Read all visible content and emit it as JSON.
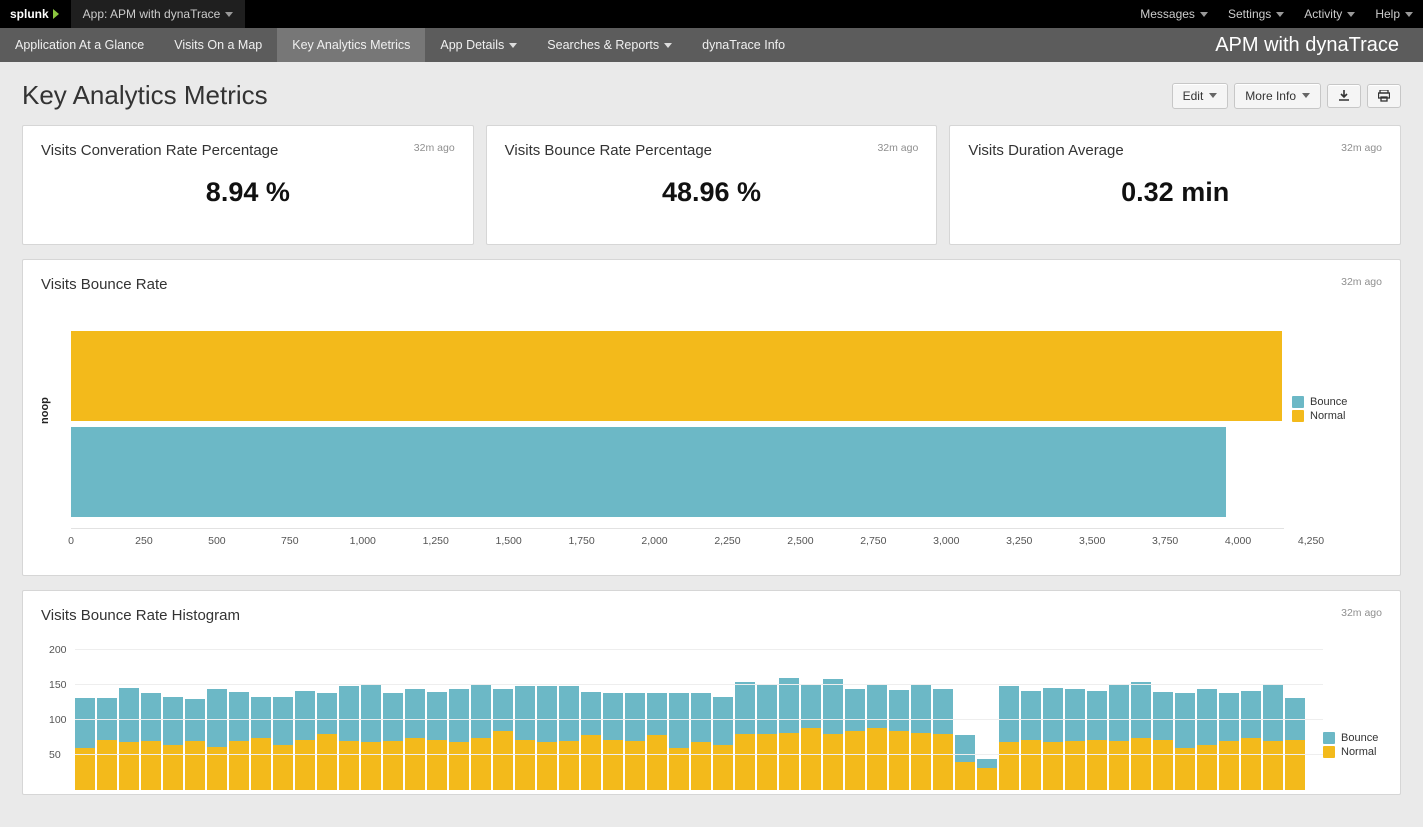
{
  "topbar": {
    "logo": "splunk",
    "app_menu_label": "App: APM with dynaTrace",
    "menu": [
      "Messages",
      "Settings",
      "Activity",
      "Help"
    ]
  },
  "navbar": {
    "items": [
      {
        "label": "Application At a Glance",
        "active": false,
        "has_caret": false
      },
      {
        "label": "Visits On a Map",
        "active": false,
        "has_caret": false
      },
      {
        "label": "Key Analytics Metrics",
        "active": true,
        "has_caret": false
      },
      {
        "label": "App Details",
        "active": false,
        "has_caret": true
      },
      {
        "label": "Searches & Reports",
        "active": false,
        "has_caret": true
      },
      {
        "label": "dynaTrace Info",
        "active": false,
        "has_caret": false
      }
    ],
    "app_title": "APM with dynaTrace"
  },
  "title_row": {
    "page_title": "Key Analytics Metrics",
    "edit_label": "Edit",
    "moreinfo_label": "More Info"
  },
  "kpi": [
    {
      "title": "Visits Converation Rate Percentage",
      "time": "32m ago",
      "value": "8.94 %"
    },
    {
      "title": "Visits Bounce Rate Percentage",
      "time": "32m ago",
      "value": "48.96 %"
    },
    {
      "title": "Visits Duration Average",
      "time": "32m ago",
      "value": "0.32 min"
    }
  ],
  "bounce_chart": {
    "title": "Visits Bounce Rate",
    "time": "32m ago",
    "yaxis_label": "noop",
    "legend": [
      "Bounce",
      "Normal"
    ],
    "colors": {
      "Bounce": "#6cb8c6",
      "Normal": "#f3ba1b"
    },
    "x_ticks": [
      "0",
      "250",
      "500",
      "750",
      "1,000",
      "1,250",
      "1,500",
      "1,750",
      "2,000",
      "2,250",
      "2,500",
      "2,750",
      "3,000",
      "3,250",
      "3,500",
      "3,750",
      "4,000",
      "4,250"
    ]
  },
  "histogram_chart": {
    "title": "Visits Bounce Rate Histogram",
    "time": "32m ago",
    "legend": [
      "Bounce",
      "Normal"
    ],
    "y_ticks": [
      "50",
      "100",
      "150",
      "200"
    ]
  },
  "chart_data": [
    {
      "type": "bar",
      "title": "Visits Bounce Rate",
      "orientation": "horizontal",
      "categories": [
        "noop"
      ],
      "series": [
        {
          "name": "Bounce",
          "values": [
            4150
          ],
          "color": "#f3ba1b"
        },
        {
          "name": "Normal",
          "values": [
            3960
          ],
          "color": "#6cb8c6"
        }
      ],
      "xlim": [
        0,
        4250
      ],
      "xlabel": "",
      "ylabel": "noop",
      "legend_labels": [
        "Bounce",
        "Normal"
      ]
    },
    {
      "type": "bar",
      "title": "Visits Bounce Rate Histogram",
      "stacked": true,
      "ylim": [
        0,
        200
      ],
      "x": [
        0,
        1,
        2,
        3,
        4,
        5,
        6,
        7,
        8,
        9,
        10,
        11,
        12,
        13,
        14,
        15,
        16,
        17,
        18,
        19,
        20,
        21,
        22,
        23,
        24,
        25,
        26,
        27,
        28,
        29,
        30,
        31,
        32,
        33,
        34,
        35,
        36,
        37,
        38,
        39,
        40,
        41,
        42,
        43,
        44,
        45,
        46,
        47,
        48,
        49,
        50,
        51,
        52,
        53,
        54,
        55
      ],
      "series": [
        {
          "name": "Normal",
          "color": "#f3ba1b",
          "values": [
            60,
            72,
            68,
            70,
            65,
            70,
            62,
            70,
            75,
            65,
            72,
            80,
            70,
            68,
            70,
            75,
            72,
            68,
            75,
            85,
            72,
            68,
            70,
            78,
            72,
            70,
            78,
            60,
            68,
            65,
            80,
            80,
            82,
            88,
            80,
            85,
            88,
            85,
            82,
            80,
            40,
            32,
            68,
            72,
            68,
            70,
            72,
            70,
            75,
            72,
            60,
            65,
            70,
            75,
            70,
            72
          ]
        },
        {
          "name": "Bounce",
          "color": "#6cb8c6",
          "values": [
            72,
            60,
            78,
            68,
            68,
            60,
            82,
            70,
            58,
            68,
            70,
            58,
            78,
            82,
            68,
            70,
            68,
            76,
            75,
            60,
            76,
            80,
            78,
            62,
            66,
            68,
            60,
            78,
            70,
            68,
            75,
            72,
            78,
            62,
            78,
            60,
            62,
            58,
            68,
            64,
            38,
            12,
            80,
            70,
            78,
            74,
            70,
            82,
            80,
            68,
            78,
            80,
            68,
            66,
            80,
            60
          ]
        }
      ],
      "legend_labels": [
        "Bounce",
        "Normal"
      ]
    }
  ]
}
